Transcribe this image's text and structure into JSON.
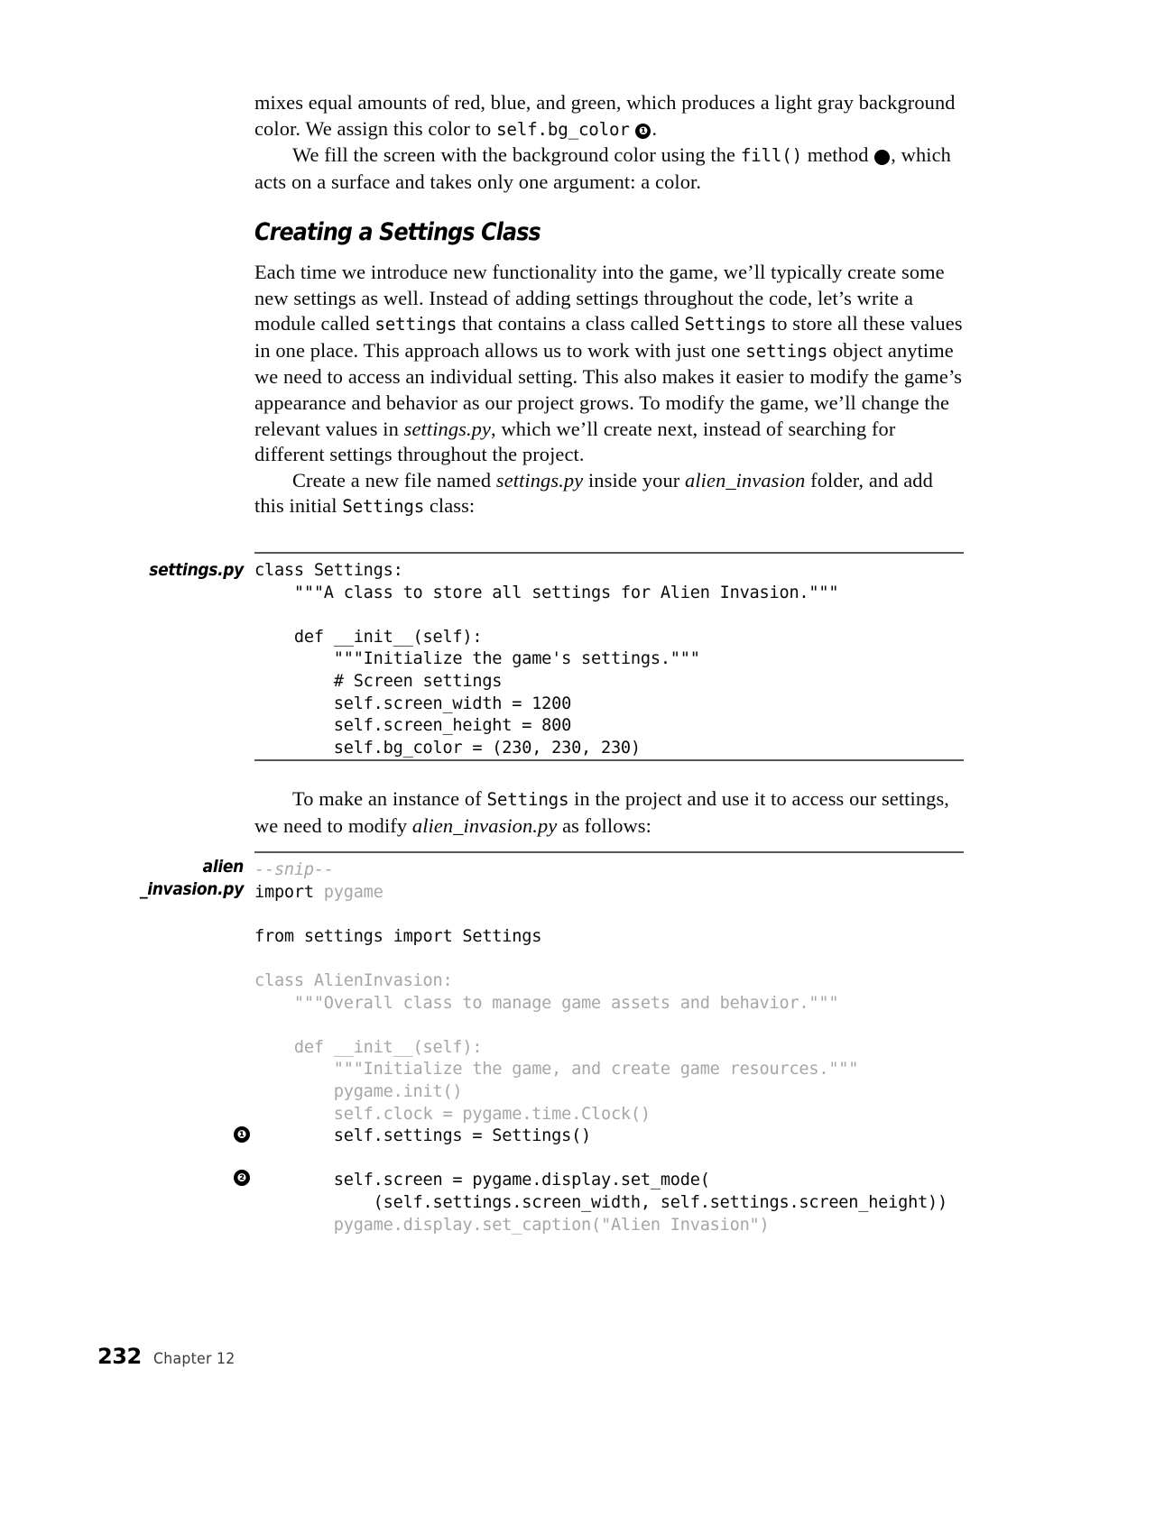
{
  "page": {
    "folio": "232",
    "chapter_label": "Chapter 12"
  },
  "intro": {
    "para1_a": "mixes equal amounts of red, blue, and green, which produces a light gray background color. We assign this color to ",
    "para1_code": "self.bg_color",
    "para1_callout": "❶",
    "para1_b": ".",
    "para2_a": "We fill the screen with the background color using the ",
    "para2_code": "fill()",
    "para2_b": " method ",
    "para2_callout": "❷",
    "para2_c": ", which acts on a surface and takes only one argument: a color."
  },
  "section": {
    "heading": "Creating a Settings Class",
    "para1_a": "Each time we introduce new functionality into the game, we’ll typically create some new settings as well. Instead of adding settings throughout the code, let’s write a module called ",
    "para1_code1": "settings",
    "para1_b": " that contains a class called ",
    "para1_code2": "Settings",
    "para1_c": " to store all these values in one place. This approach allows us to work with just one ",
    "para1_code3": "settings",
    "para1_d": " object anytime we need to access an individual setting. This also makes it easier to modify the game’s appearance and behavior as our project grows. To modify the game, we’ll change the relevant values in ",
    "para1_ital1": "settings.py",
    "para1_e": ", which we’ll create next, instead of searching for different settings throughout the project.",
    "para2_a": "Create a new file named ",
    "para2_ital1": "settings.py",
    "para2_b": " inside your ",
    "para2_ital2": "alien_invasion",
    "para2_c": " folder, and add this initial ",
    "para2_code": "Settings",
    "para2_d": " class:"
  },
  "listing1": {
    "file_label": "settings.py",
    "lines": [
      "class Settings:",
      "    \"\"\"A class to store all settings for Alien Invasion.\"\"\"",
      "",
      "    def __init__(self):",
      "        \"\"\"Initialize the game's settings.\"\"\"",
      "        # Screen settings",
      "        self.screen_width = 1200",
      "        self.screen_height = 800",
      "        self.bg_color = (230, 230, 230)"
    ]
  },
  "bridge": {
    "para_a": "To make an instance of ",
    "para_code": "Settings",
    "para_b": " in the project and use it to access our settings, we need to modify ",
    "para_ital": "alien_invasion.py",
    "para_c": " as follows:"
  },
  "listing2": {
    "file_label_line1": "alien",
    "file_label_line2": "_invasion.py",
    "callout1": "❶",
    "callout2": "❷",
    "lines": [
      {
        "text": "--snip--",
        "style": "dim-i"
      },
      {
        "text": "import pygame",
        "style": "mixed_import"
      },
      {
        "text": "",
        "style": "blank"
      },
      {
        "text": "from settings import Settings",
        "style": "normal"
      },
      {
        "text": "",
        "style": "blank"
      },
      {
        "text": "class AlienInvasion:",
        "style": "dim"
      },
      {
        "text": "    \"\"\"Overall class to manage game assets and behavior.\"\"\"",
        "style": "dim"
      },
      {
        "text": "",
        "style": "blank"
      },
      {
        "text": "    def __init__(self):",
        "style": "dim"
      },
      {
        "text": "        \"\"\"Initialize the game, and create game resources.\"\"\"",
        "style": "dim"
      },
      {
        "text": "        pygame.init()",
        "style": "dim"
      },
      {
        "text": "        self.clock = pygame.time.Clock()",
        "style": "dim"
      },
      {
        "text": "        self.settings = Settings()",
        "style": "normal"
      },
      {
        "text": "",
        "style": "blank"
      },
      {
        "text": "        self.screen = pygame.display.set_mode(",
        "style": "normal"
      },
      {
        "text": "            (self.settings.screen_width, self.settings.screen_height))",
        "style": "normal"
      },
      {
        "text": "        pygame.display.set_caption(\"Alien Invasion\")",
        "style": "dim"
      }
    ],
    "import_keyword": "import",
    "import_module": " pygame"
  }
}
